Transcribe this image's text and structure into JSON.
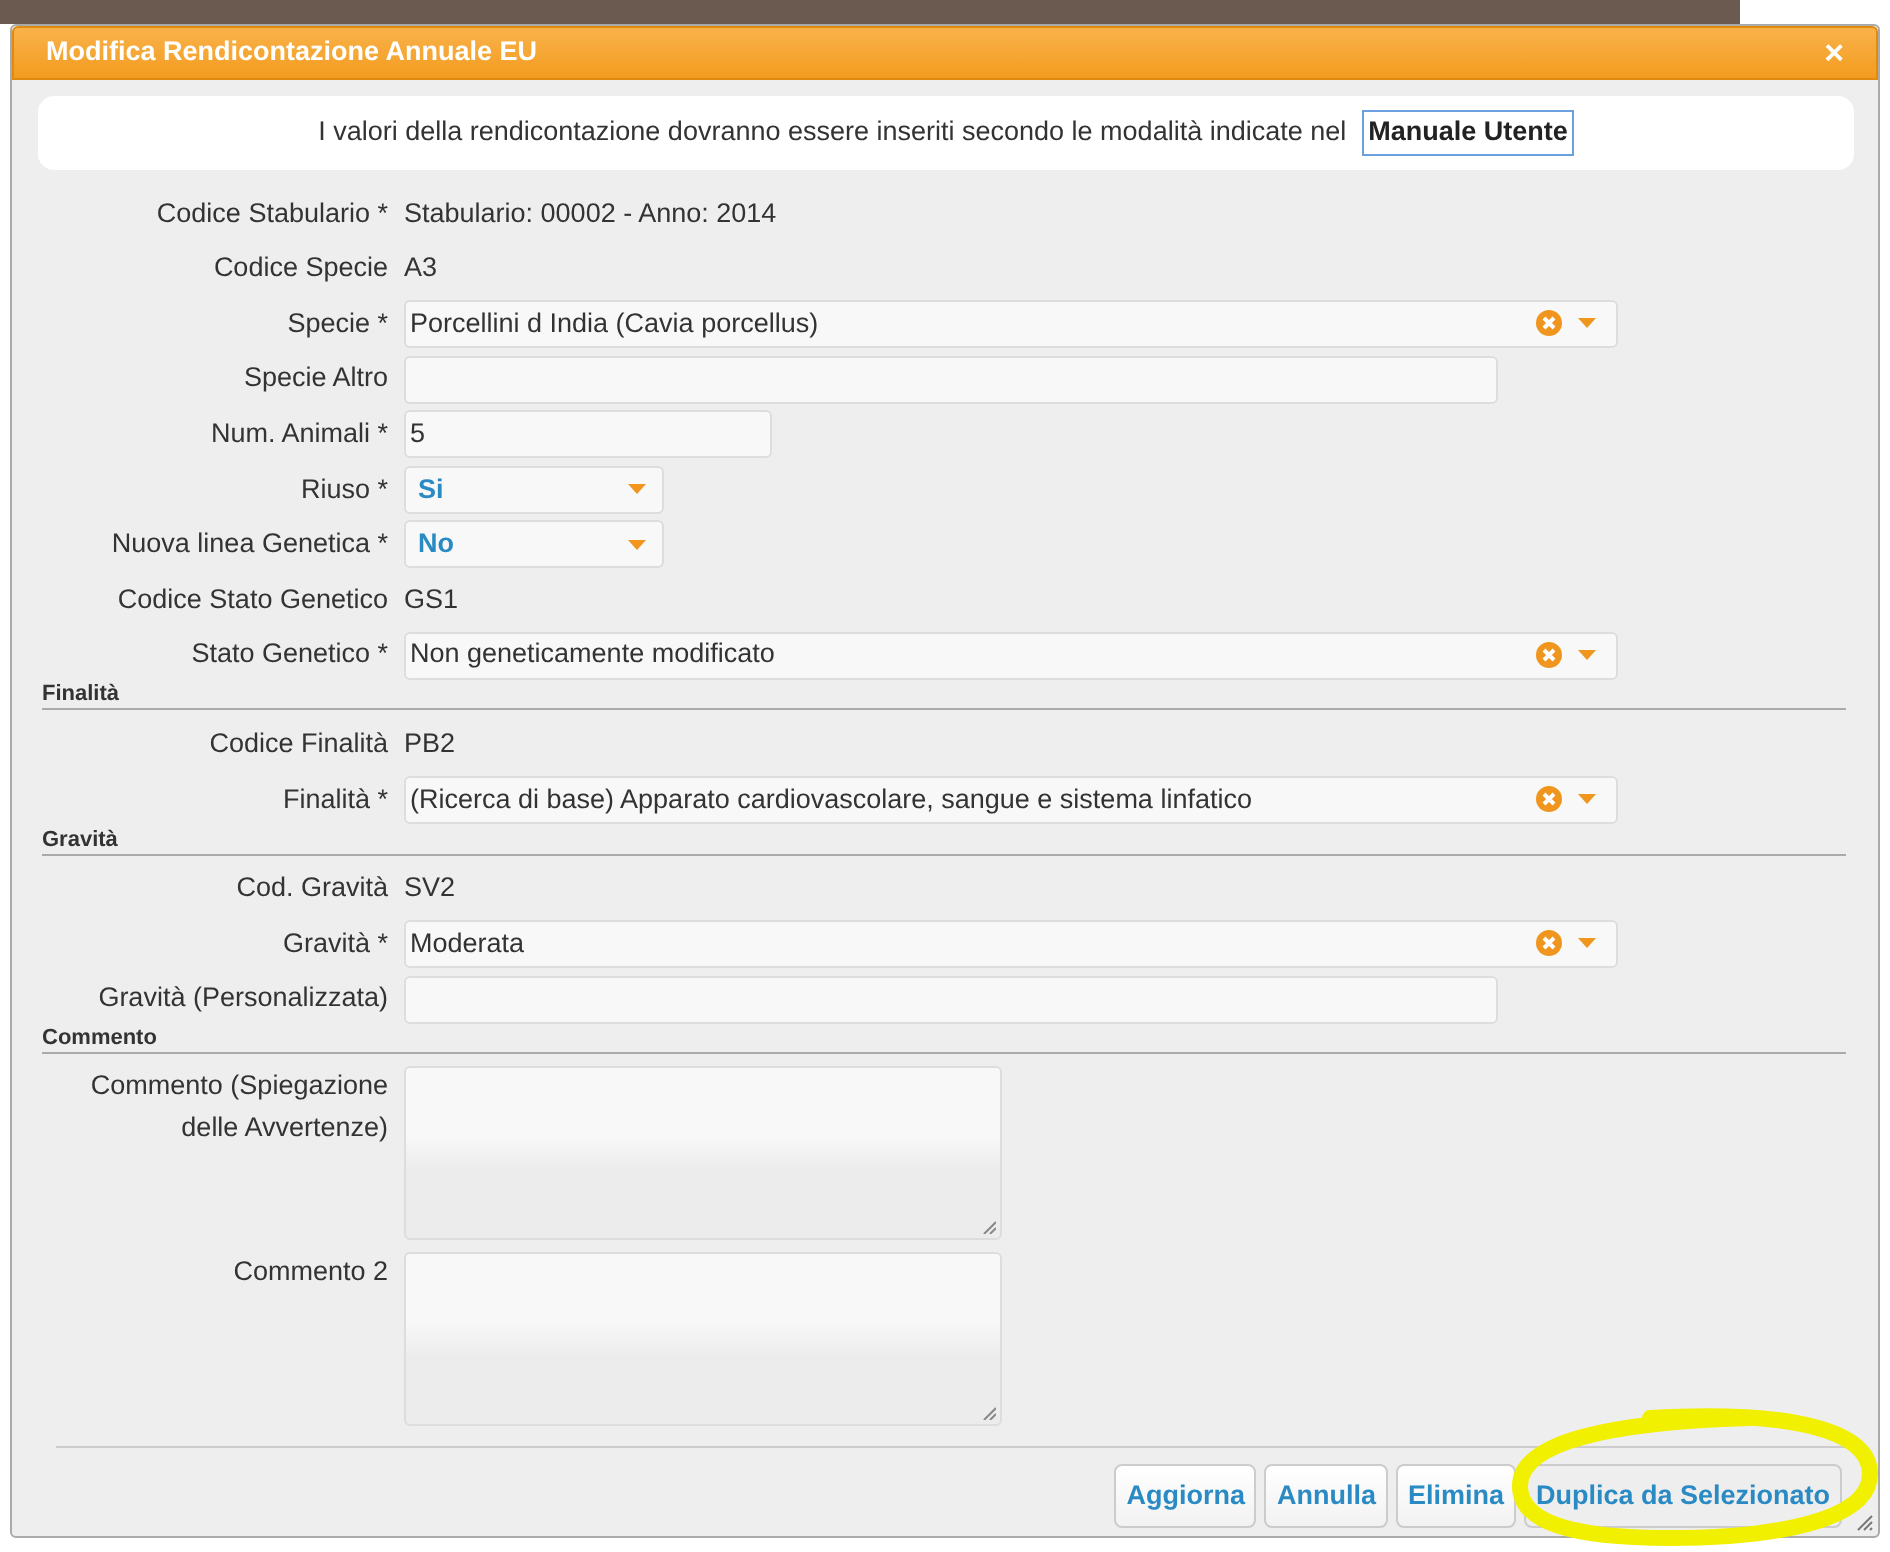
{
  "dialog": {
    "title": "Modifica Rendicontazione Annuale EU",
    "close": "×"
  },
  "notice": {
    "text": "I valori della rendicontazione dovranno essere inseriti secondo le modalità indicate nel",
    "link": "Manuale Utente"
  },
  "fields": [
    {
      "kind": "static",
      "label": "Codice Stabulario *",
      "value": "Stabulario: 00002 - Anno: 2014"
    },
    {
      "kind": "static",
      "label": "Codice Specie",
      "value": "A3"
    },
    {
      "kind": "combo",
      "label": "Specie *",
      "value": "Porcellini d India (Cavia porcellus)"
    },
    {
      "kind": "text_wide",
      "label": "Specie Altro"
    },
    {
      "kind": "text_short",
      "label": "Num. Animali *",
      "value": "5"
    },
    {
      "kind": "select",
      "label": "Riuso *",
      "value": "Si"
    },
    {
      "kind": "select",
      "label": "Nuova linea Genetica *",
      "value": "No"
    },
    {
      "kind": "static",
      "label": "Codice Stato Genetico",
      "value": "GS1"
    },
    {
      "kind": "combo",
      "label": "Stato Genetico *",
      "value": "Non geneticamente modificato"
    },
    {
      "kind": "section",
      "label": "Finalità"
    },
    {
      "kind": "static",
      "label": "Codice Finalità",
      "value": "PB2"
    },
    {
      "kind": "combo",
      "label": "Finalità *",
      "value": "(Ricerca di base) Apparato cardiovascolare, sangue e sistema linfatico"
    },
    {
      "kind": "section",
      "label": "Gravità"
    },
    {
      "kind": "static",
      "label": "Cod. Gravità",
      "value": "SV2"
    },
    {
      "kind": "combo",
      "label": "Gravità *",
      "value": "Moderata"
    },
    {
      "kind": "text_wide",
      "label": "Gravità (Personalizzata)"
    },
    {
      "kind": "section",
      "label": "Commento"
    },
    {
      "kind": "textarea",
      "label": "Commento (Spiegazione delle Avvertenze)"
    },
    {
      "kind": "textarea",
      "label": "Commento 2"
    }
  ],
  "buttons": [
    {
      "label": "Aggiorna",
      "highlighted": false
    },
    {
      "label": "Annulla",
      "highlighted": false
    },
    {
      "label": "Elimina",
      "highlighted": false
    },
    {
      "label": "Duplica da Selezionato",
      "highlighted": true
    }
  ]
}
